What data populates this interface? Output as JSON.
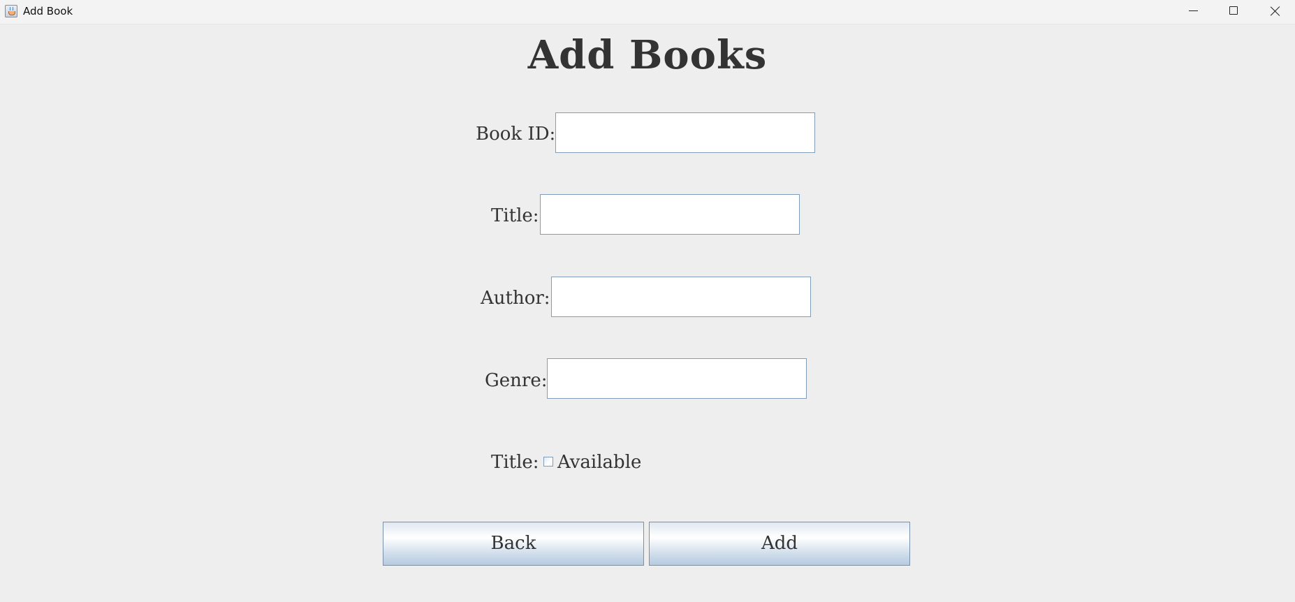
{
  "window": {
    "title": "Add Book",
    "controls": {
      "minimize": "minimize-icon",
      "maximize": "maximize-icon",
      "close": "close-icon"
    }
  },
  "form": {
    "heading": "Add Books",
    "book_id": {
      "label": "Book ID:",
      "value": ""
    },
    "title": {
      "label": "Title:",
      "value": ""
    },
    "author": {
      "label": "Author:",
      "value": ""
    },
    "genre": {
      "label": "Genre:",
      "value": ""
    },
    "availability": {
      "label": "Title:",
      "checkbox_label": "Available",
      "checked": false
    }
  },
  "buttons": {
    "back": "Back",
    "add": "Add"
  },
  "colors": {
    "background": "#eeeeee",
    "text": "#333333",
    "field_border": "#7f9db9",
    "button_gradient_bottom": "#b7cbe0"
  }
}
